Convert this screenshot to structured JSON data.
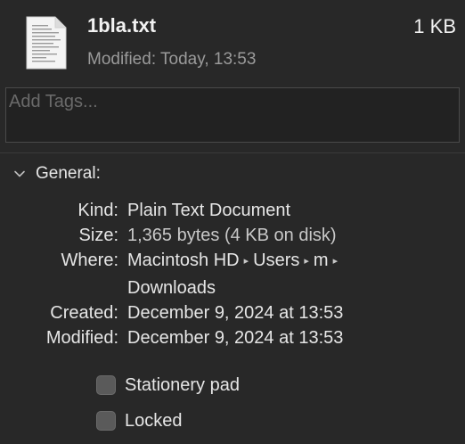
{
  "header": {
    "file_name": "1bla.txt",
    "file_size": "1 KB",
    "modified_label": "Modified:",
    "modified_value": "Today, 13:53",
    "icon": "text-document-icon"
  },
  "tags": {
    "placeholder": "Add Tags...",
    "value": ""
  },
  "general": {
    "title": "General:",
    "expanded": true,
    "kind_label": "Kind:",
    "kind_value": "Plain Text Document",
    "size_label": "Size:",
    "size_value": "1,365 bytes (4 KB on disk)",
    "where_label": "Where:",
    "path": [
      "Macintosh HD",
      "Users",
      "m",
      "Downloads"
    ],
    "path_separator": "▸",
    "created_label": "Created:",
    "created_value": "December 9, 2024 at 13:53",
    "modified_label": "Modified:",
    "modified_value": "December 9, 2024 at 13:53"
  },
  "options": {
    "stationery_label": "Stationery pad",
    "stationery_checked": false,
    "locked_label": "Locked",
    "locked_checked": false
  },
  "colors": {
    "background": "#282828",
    "text": "#e6e6e6",
    "secondary_text": "#9a9a9a",
    "checkbox_fill": "#5a5a5a"
  }
}
